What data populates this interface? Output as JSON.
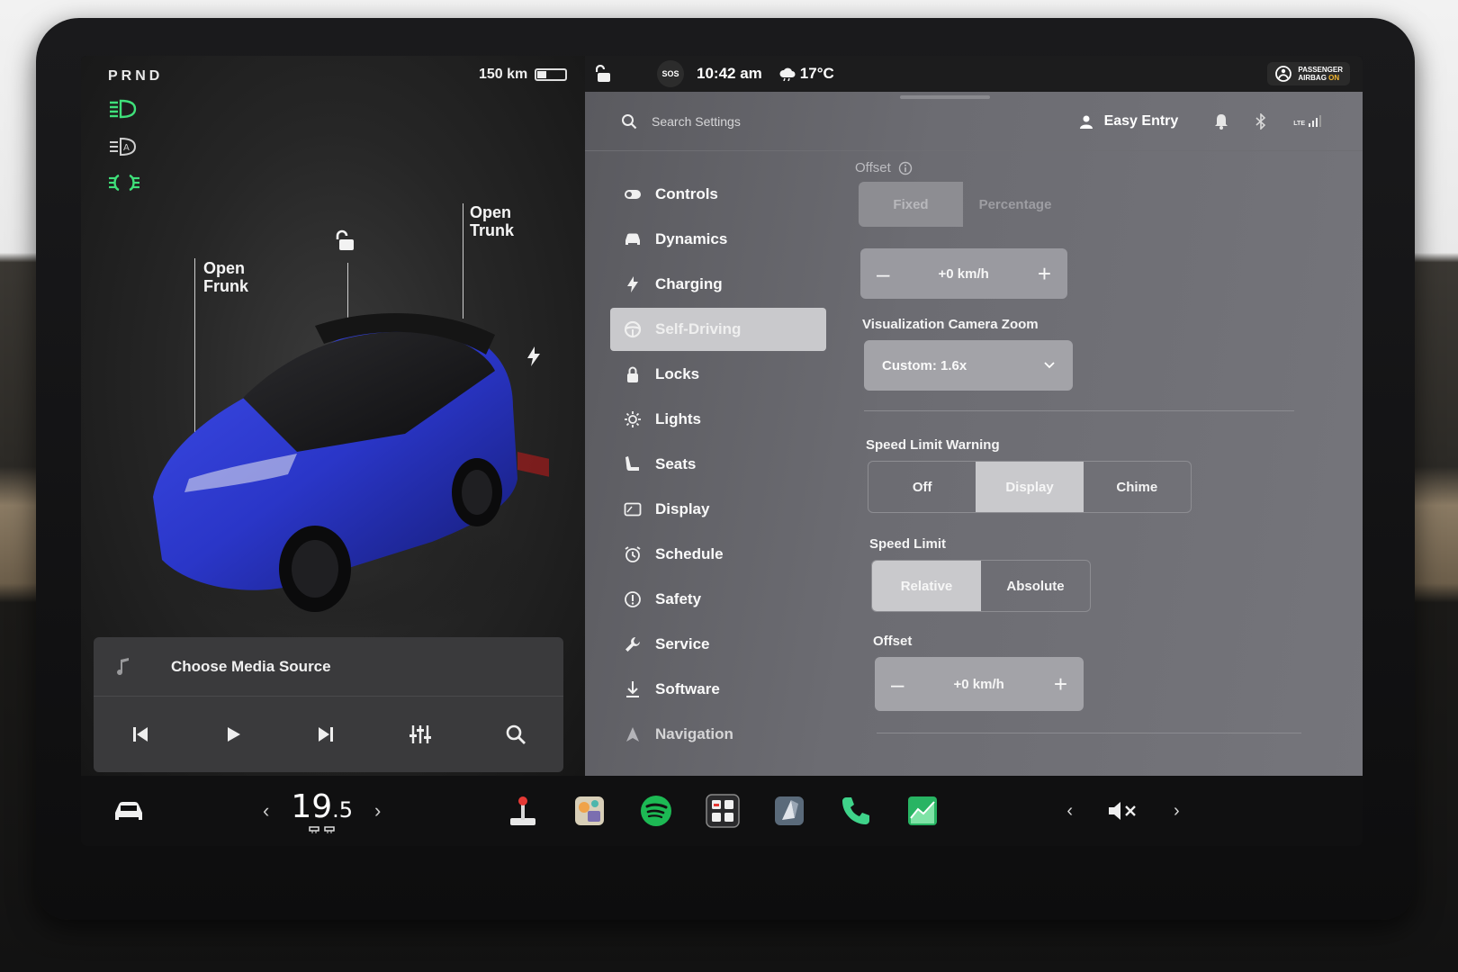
{
  "vehicle": {
    "gear": "PRND",
    "range": "150 km",
    "open_frunk": "Open\nFrunk",
    "open_trunk": "Open\nTrunk"
  },
  "status_bar": {
    "sos": "SOS",
    "time": "10:42 am",
    "temperature": "17°C",
    "airbag_line1": "PASSENGER",
    "airbag_line2": "AIRBAG",
    "airbag_state": "ON"
  },
  "settings_header": {
    "search_placeholder": "Search Settings",
    "profile": "Easy Entry",
    "signal": "LTE"
  },
  "nav": [
    {
      "label": "Controls",
      "icon": "toggle-icon"
    },
    {
      "label": "Dynamics",
      "icon": "car-front-icon"
    },
    {
      "label": "Charging",
      "icon": "bolt-icon"
    },
    {
      "label": "Self-Driving",
      "icon": "steering-wheel-icon",
      "active": true
    },
    {
      "label": "Locks",
      "icon": "lock-icon"
    },
    {
      "label": "Lights",
      "icon": "sun-icon"
    },
    {
      "label": "Seats",
      "icon": "seat-icon"
    },
    {
      "label": "Display",
      "icon": "display-icon"
    },
    {
      "label": "Schedule",
      "icon": "alarm-icon"
    },
    {
      "label": "Safety",
      "icon": "alert-circle-icon"
    },
    {
      "label": "Service",
      "icon": "wrench-icon"
    },
    {
      "label": "Software",
      "icon": "download-icon"
    },
    {
      "label": "Navigation",
      "icon": "navigation-icon"
    }
  ],
  "content": {
    "offset_top_label": "Offset",
    "offset_mode_options": [
      "Fixed",
      "Percentage"
    ],
    "offset_mode_selected": "Fixed",
    "offset_top_value": "+0 km/h",
    "camera_zoom_label": "Visualization Camera Zoom",
    "camera_zoom_value": "Custom: 1.6x",
    "speed_warning_label": "Speed Limit Warning",
    "speed_warning_options": [
      "Off",
      "Display",
      "Chime"
    ],
    "speed_warning_selected": "Display",
    "speed_limit_label": "Speed Limit",
    "speed_limit_options": [
      "Relative",
      "Absolute"
    ],
    "speed_limit_selected": "Relative",
    "offset_bottom_label": "Offset",
    "offset_bottom_value": "+0 km/h",
    "minus": "–",
    "plus": "+"
  },
  "media": {
    "title": "Choose Media Source"
  },
  "dock": {
    "cabin_temp_whole": "19",
    "cabin_temp_decimal": ".5",
    "left_arrow": "‹",
    "right_arrow": "›"
  },
  "colors": {
    "lamp_green": "#3fe07a",
    "airbag_amber": "#f2b630",
    "car_blue": "#2a36c8",
    "spotify_green": "#1db954"
  }
}
